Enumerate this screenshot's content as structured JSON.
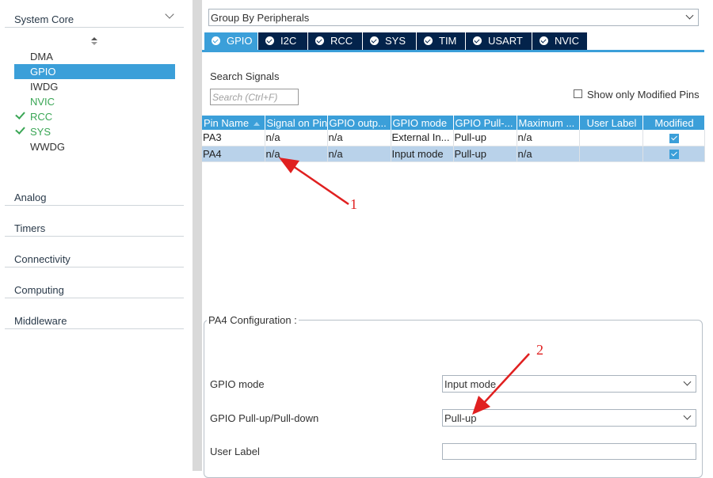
{
  "left": {
    "system_core": {
      "label": "System Core"
    },
    "items": [
      {
        "label": "DMA",
        "state": "normal"
      },
      {
        "label": "GPIO",
        "state": "selected"
      },
      {
        "label": "IWDG",
        "state": "normal"
      },
      {
        "label": "NVIC",
        "state": "green"
      },
      {
        "label": "RCC",
        "state": "checked"
      },
      {
        "label": "SYS",
        "state": "checked"
      },
      {
        "label": "WWDG",
        "state": "normal"
      }
    ],
    "categories": [
      "Analog",
      "Timers",
      "Connectivity",
      "Computing",
      "Middleware"
    ]
  },
  "group_combo": {
    "value": "Group By Peripherals"
  },
  "tabs": [
    "GPIO",
    "I2C",
    "RCC",
    "SYS",
    "TIM",
    "USART",
    "NVIC"
  ],
  "search": {
    "title": "Search Signals",
    "placeholder": "Search (Ctrl+F)"
  },
  "show_modified": {
    "label": "Show only Modified Pins"
  },
  "table": {
    "headers": [
      "Pin Name",
      "Signal on Pin",
      "GPIO outp...",
      "GPIO mode",
      "GPIO Pull-...",
      "Maximum ...",
      "User Label",
      "Modified"
    ],
    "rows": [
      {
        "pin": "PA3",
        "signal": "n/a",
        "output": "n/a",
        "mode": "External In...",
        "pull": "Pull-up",
        "max": "n/a",
        "label": "",
        "modified": true
      },
      {
        "pin": "PA4",
        "signal": "n/a",
        "output": "n/a",
        "mode": "Input mode",
        "pull": "Pull-up",
        "max": "n/a",
        "label": "",
        "modified": true
      }
    ]
  },
  "config": {
    "legend": "PA4 Configuration :",
    "gpio_mode": {
      "label": "GPIO mode",
      "value": "Input mode"
    },
    "gpio_pull": {
      "label": "GPIO Pull-up/Pull-down",
      "value": "Pull-up"
    },
    "user_label": {
      "label": "User Label",
      "value": ""
    }
  },
  "annotations": [
    "1",
    "2"
  ],
  "colors": {
    "accent": "#3b9fd9",
    "tab_dark": "#03234b",
    "annotation": "#e02020",
    "enabled_green": "#3aa655"
  }
}
